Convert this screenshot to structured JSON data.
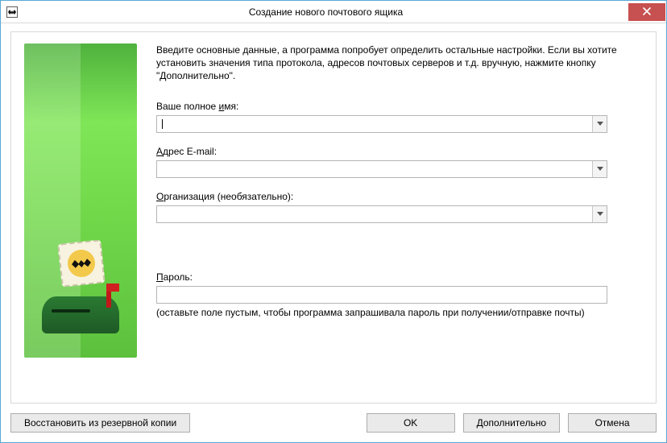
{
  "window": {
    "title": "Создание нового почтового ящика"
  },
  "intro": "Введите основные данные, а программа попробует определить остальные настройки. Если вы хотите установить значения типа протокола, адресов почтовых серверов и т.д. вручную, нажмите кнопку \"Дополнительно\".",
  "fields": {
    "name": {
      "label_pre": "Ваше полное ",
      "label_u": "и",
      "label_post": "мя:",
      "value": ""
    },
    "email": {
      "label_pre": "",
      "label_u": "А",
      "label_post": "дрес E-mail:",
      "value": ""
    },
    "org": {
      "label_pre": "",
      "label_u": "О",
      "label_post": "рганизация (необязательно):",
      "value": ""
    },
    "password": {
      "label_pre": "",
      "label_u": "П",
      "label_post": "ароль:",
      "value": "",
      "hint": "(оставьте поле пустым, чтобы программа запрашивала пароль при получении/отправке почты)"
    }
  },
  "buttons": {
    "restore": "Восстановить из резервной копии",
    "ok": "OK",
    "advanced": "Дополнительно",
    "cancel": "Отмена"
  }
}
